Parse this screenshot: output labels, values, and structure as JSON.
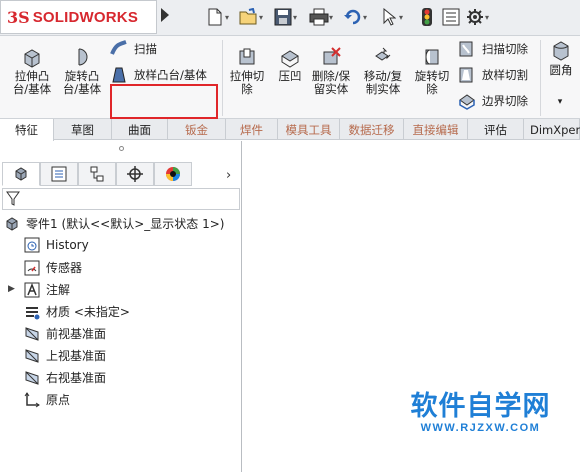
{
  "app": {
    "logo_prefix": "3S",
    "logo_solid": "SOLID",
    "logo_works": "WORKS"
  },
  "quick_access": {
    "icons": [
      "new-document-icon",
      "open-folder-icon",
      "save-icon",
      "print-icon",
      "undo-icon",
      "select-cursor-icon",
      "traffic-light-icon",
      "file-properties-icon",
      "gear-icon"
    ]
  },
  "ribbon": {
    "extruded_boss": "拉伸凸\n台/基体",
    "revolved_boss": "旋转凸\n台/基体",
    "sweep": "扫描",
    "loft": "放样凸台/基体",
    "extruded_cut": "拉伸切\n除",
    "indent": "压凹",
    "delete_keep_body": "删除/保\n留实体",
    "move_copy_body": "移动/复\n制实体",
    "revolved_cut": "旋转切\n除",
    "swept_cut": "扫描切除",
    "lofted_cut": "放样切割",
    "boundary_cut": "边界切除",
    "fillet": "圆角",
    "more": "▾"
  },
  "tabs": [
    {
      "label": "特征",
      "active": true
    },
    {
      "label": "草图",
      "active": false
    },
    {
      "label": "曲面",
      "active": false
    },
    {
      "label": "钣金",
      "dim": true
    },
    {
      "label": "焊件",
      "dim": true
    },
    {
      "label": "模具工具",
      "dim": true
    },
    {
      "label": "数据迁移",
      "dim": true
    },
    {
      "label": "直接编辑",
      "dim": true
    },
    {
      "label": "评估",
      "active": false
    },
    {
      "label": "DimXpert",
      "active": false
    }
  ],
  "panel": {
    "tabs": [
      "feature-manager-icon",
      "property-manager-icon",
      "configuration-manager-icon",
      "dimxpert-icon",
      "display-manager-icon"
    ],
    "tree": {
      "root": "零件1  (默认<<默认>_显示状态 1>)",
      "items": [
        {
          "label": "History",
          "icon": "history-icon"
        },
        {
          "label": "传感器",
          "icon": "sensor-icon"
        },
        {
          "label": "注解",
          "icon": "annotations-icon"
        },
        {
          "label": "材质 <未指定>",
          "icon": "material-icon"
        },
        {
          "label": "前视基准面",
          "icon": "plane-icon"
        },
        {
          "label": "上视基准面",
          "icon": "plane-icon"
        },
        {
          "label": "右视基准面",
          "icon": "plane-icon"
        },
        {
          "label": "原点",
          "icon": "origin-icon"
        }
      ]
    }
  },
  "watermark": {
    "main": "软件自学网",
    "sub": "WWW.RJZXW.COM"
  }
}
